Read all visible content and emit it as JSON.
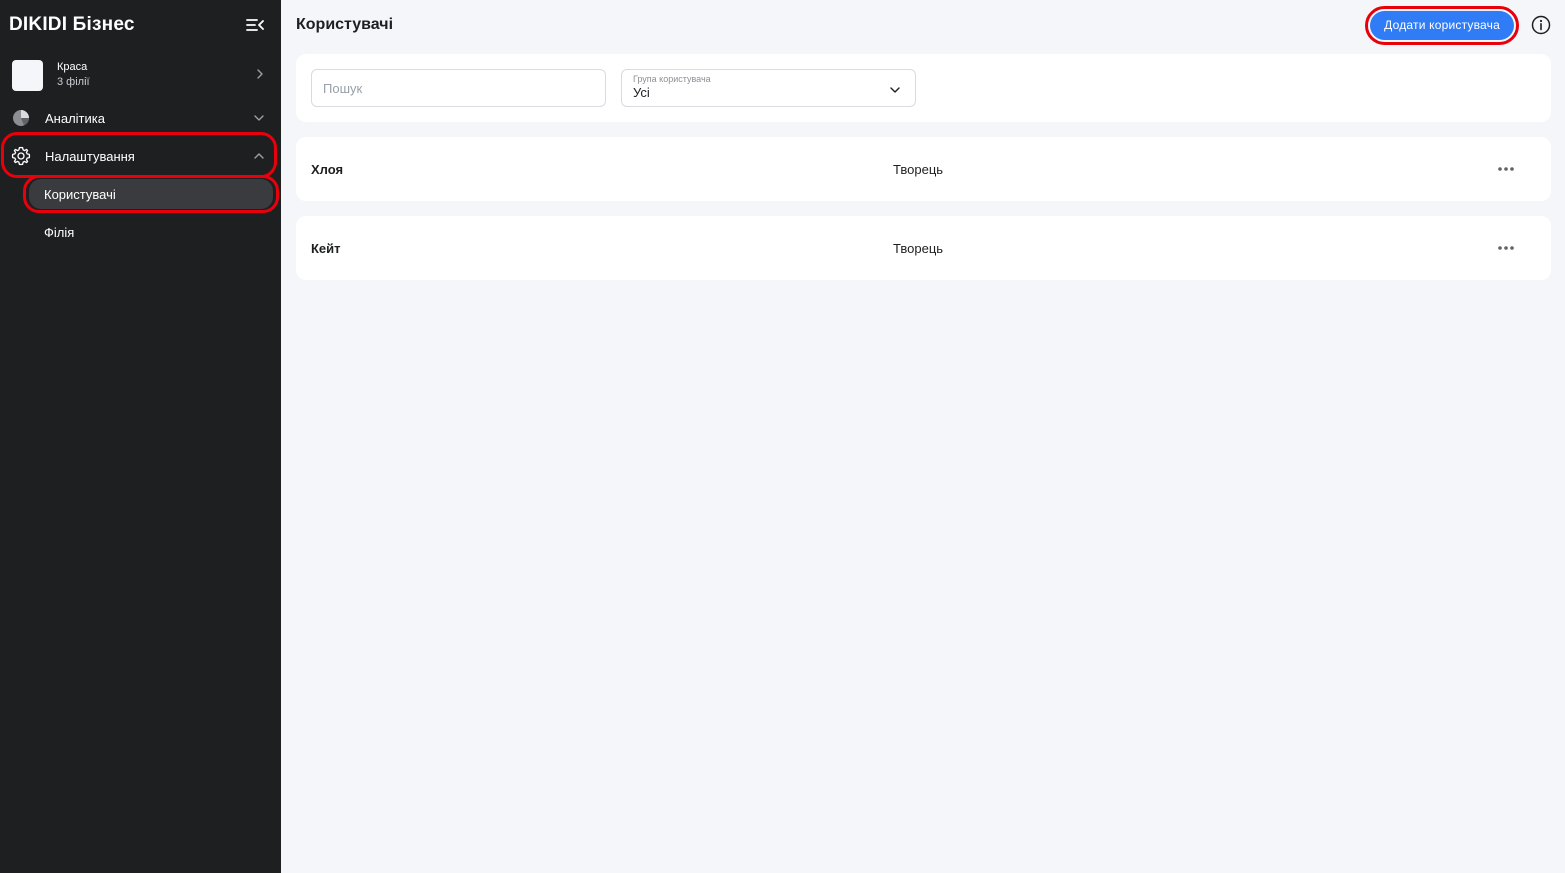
{
  "sidebar": {
    "brand": "DIKIDI Бізнес",
    "company": {
      "name": "Краса",
      "branches": "3 філії"
    },
    "nav": {
      "analytics": "Аналітика",
      "settings": "Налаштування",
      "sub_items": [
        "Користувачі",
        "Філія"
      ]
    }
  },
  "header": {
    "title": "Користувачі",
    "add_user_label": "Додати користувача"
  },
  "filters": {
    "search_placeholder": "Пошук",
    "search_value": "",
    "group_label": "Група користувача",
    "group_value": "Усі"
  },
  "users": [
    {
      "name": "Хлоя",
      "role": "Творець"
    },
    {
      "name": "Кейт",
      "role": "Творець"
    }
  ],
  "colors": {
    "sidebar_bg": "#1e1f21",
    "accent_blue": "#2f7cf6",
    "highlight_red": "#e8000b",
    "main_bg": "#f4f6fa"
  }
}
